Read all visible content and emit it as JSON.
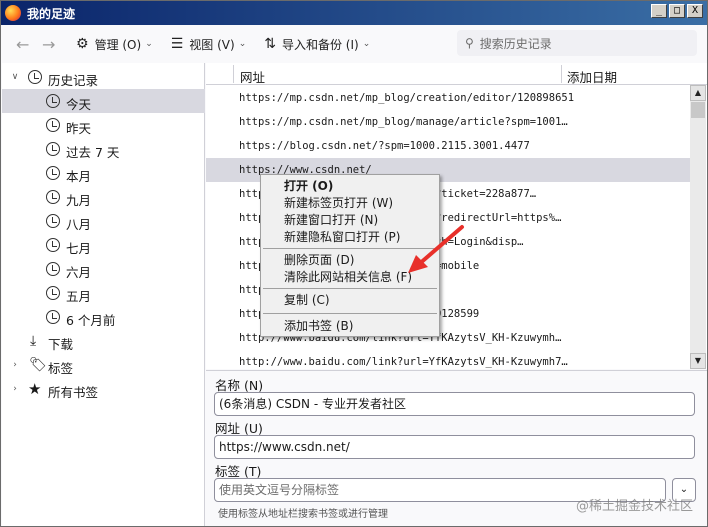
{
  "window": {
    "title": "我的足迹",
    "buttons": {
      "minimize": "_",
      "maximize": "□",
      "close": "X"
    }
  },
  "toolbar": {
    "back_icon": "←",
    "forward_icon": "→",
    "manage_label": "管理 (O)",
    "views_label": "视图 (V)",
    "import_backup_label": "导入和备份 (I)",
    "search_placeholder": "搜索历史记录"
  },
  "sidebar": {
    "history_root": "历史记录",
    "history_items": [
      "今天",
      "昨天",
      "过去 7 天",
      "本月",
      "九月",
      "八月",
      "七月",
      "六月",
      "五月",
      "6 个月前"
    ],
    "selected_item": "今天",
    "downloads": "下载",
    "tags": "标签",
    "all_bookmarks": "所有书签"
  },
  "table": {
    "columns": {
      "url": "网址",
      "date_added": "添加日期"
    },
    "rows": [
      "https://mp.csdn.net/mp_blog/creation/editor/120898651",
      "https://mp.csdn.net/mp_blog/manage/article?spm=1001…",
      "https://blog.csdn.net/?spm=1000.2115.3001.4477",
      "https://www.csdn.net/",
      "https://passport.csdn.net/login?ticket=228a877…",
      "https://passport.csdn.net/login?redirectUrl=https%…",
      "https://passport.csdn.net/?search=Login&disp…",
      "https://passport.csdn.net/?code=mobile",
      "https://",
      "https://blog.csdn.net/weixin_100128599",
      "http://www.baidu.com/link?url=YfKAzytsV_KH-Kzuwymh…",
      "http://www.baidu.com/link?url=YfKAzytsV_KH-Kzuwymh7…"
    ],
    "selected_row": 3
  },
  "context_menu": {
    "items": [
      {
        "label": "打开 (O)",
        "bold": true
      },
      {
        "label": "新建标签页打开 (W)"
      },
      {
        "label": "新建窗口打开 (N)"
      },
      {
        "label": "新建隐私窗口打开 (P)"
      },
      {
        "label": "删除页面 (D)"
      },
      {
        "label": "清除此网站相关信息 (F)"
      },
      {
        "label": "复制 (C)"
      },
      {
        "label": "添加书签 (B)"
      }
    ],
    "highlight_color": "#e8302a"
  },
  "details": {
    "name_label": "名称 (N)",
    "name_value": "(6条消息) CSDN - 专业开发者社区",
    "url_label": "网址 (U)",
    "url_value": "https://www.csdn.net/",
    "tags_label": "标签 (T)",
    "tags_placeholder": "使用英文逗号分隔标签",
    "hint": "使用标签从地址栏搜索书签或进行管理"
  },
  "watermark": "@稀土掘金技术社区"
}
